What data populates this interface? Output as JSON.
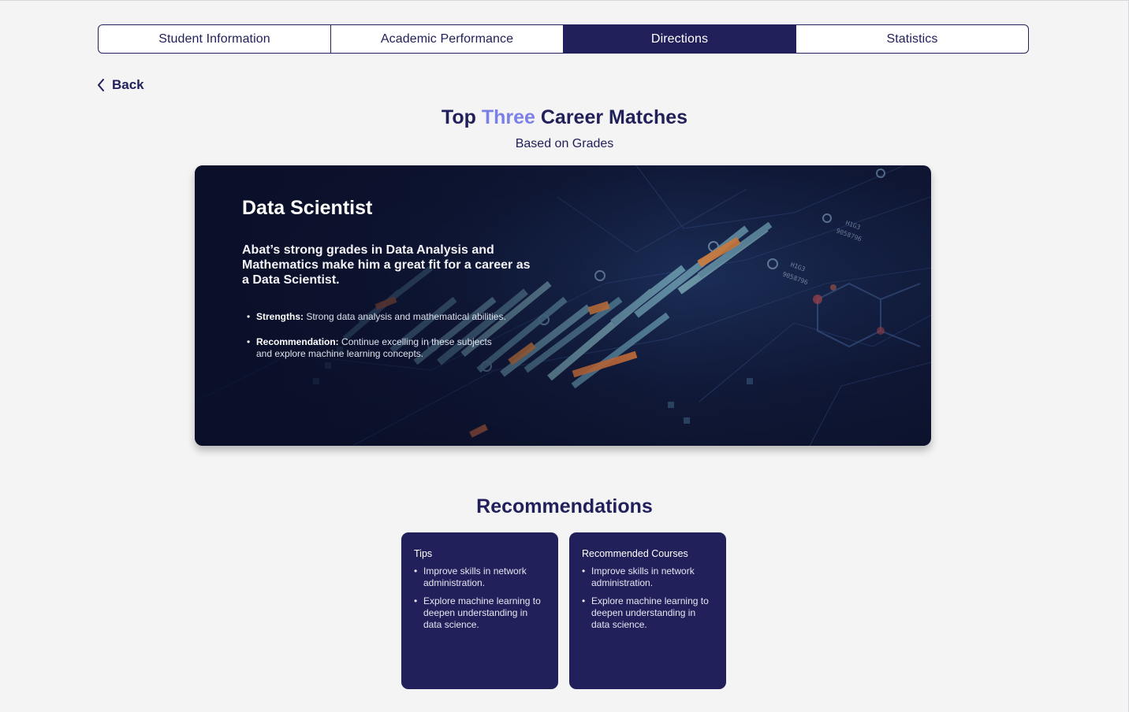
{
  "tabs": [
    {
      "label": "Student Information"
    },
    {
      "label": "Academic Performance"
    },
    {
      "label": "Directions"
    },
    {
      "label": "Statistics"
    }
  ],
  "active_tab": "Directions",
  "back_label": "Back",
  "header": {
    "title_pre": "Top ",
    "title_accent": "Three",
    "title_post": " Career Matches",
    "subtitle": "Based on Grades"
  },
  "career": {
    "title": "Data Scientist",
    "description": "Abat’s strong grades in Data Analysis and Mathematics make him a great fit for a career as a Data Scientist.",
    "points": [
      {
        "label": "Strengths:",
        "text": " Strong data analysis and mathematical abilities."
      },
      {
        "label": "Recommendation:",
        "text": " Continue excelling in these subjects and explore machine learning concepts."
      }
    ]
  },
  "recommendations": {
    "title": "Recommendations",
    "cards": [
      {
        "heading": "Tips",
        "items": [
          "Improve skills in network administration.",
          "Explore machine learning to deepen understanding in data science."
        ]
      },
      {
        "heading": "Recommended Courses",
        "items": [
          "Improve skills in network administration.",
          "Explore machine learning to deepen understanding in data science."
        ]
      }
    ]
  },
  "colors": {
    "primary": "#22205a",
    "accent": "#7b7fe8",
    "background": "#f4f4f5"
  },
  "icons": {
    "back": "chevron-left-icon"
  }
}
